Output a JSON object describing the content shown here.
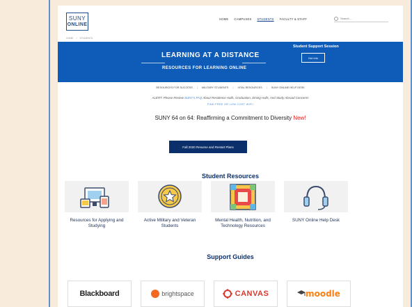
{
  "header": {
    "logo_line1": "SUNY",
    "logo_line2": "ONLINE",
    "nav": [
      "HOME",
      "CAMPUSES",
      "STUDENTS",
      "FACULTY & STAFF"
    ],
    "search_placeholder": "Search ..."
  },
  "breadcrumb": [
    "HOME",
    "/",
    "STUDENTS"
  ],
  "banner": {
    "title": "LEARNING AT A DISTANCE",
    "subtitle": "RESOURCES FOR LEARNING ONLINE",
    "session_title": "Student Support Session",
    "session_button": "Get Info"
  },
  "subnav": [
    "RESOURCES FOR SUCCESS",
    "MILITARY STUDENTS",
    "VITAL RESOURCES",
    "SUNY ONLINE HELP DESK"
  ],
  "alert": {
    "prefix": "ALERT: Please Review ",
    "link": "SUNY's FAQ",
    "suffix": " About Residence Halls, Graduation, Dining Halls, And Study Abroad Concerns"
  },
  "wifi_link": "FIND FREE OR LOW COST WIFI!",
  "headline": {
    "text": "SUNY 64 on 64: Reaffirming a Commitment to Diversity ",
    "badge": "New!"
  },
  "plan_button": "Fall 2020 Resume and Restart Plans",
  "student_resources": {
    "title": "Student Resources",
    "cards": [
      {
        "label": "Resources for Applying and Studying",
        "icon": "devices-icon"
      },
      {
        "label": "Active Military and Veteran Students",
        "icon": "star-badge-icon"
      },
      {
        "label": "Mental Health, Nutrition, and Technology Resources",
        "icon": "grid-frame-icon"
      },
      {
        "label": "SUNY Online Help Desk",
        "icon": "headset-icon"
      }
    ]
  },
  "support_guides": {
    "title": "Support Guides",
    "logos": [
      "Blackboard",
      "brightspace",
      "CANVAS",
      "moodle"
    ]
  },
  "colors": {
    "banner": "#0f5bb8",
    "navy": "#0b2f6b",
    "alert_red": "#e32020",
    "background": "#f8ebdc"
  }
}
